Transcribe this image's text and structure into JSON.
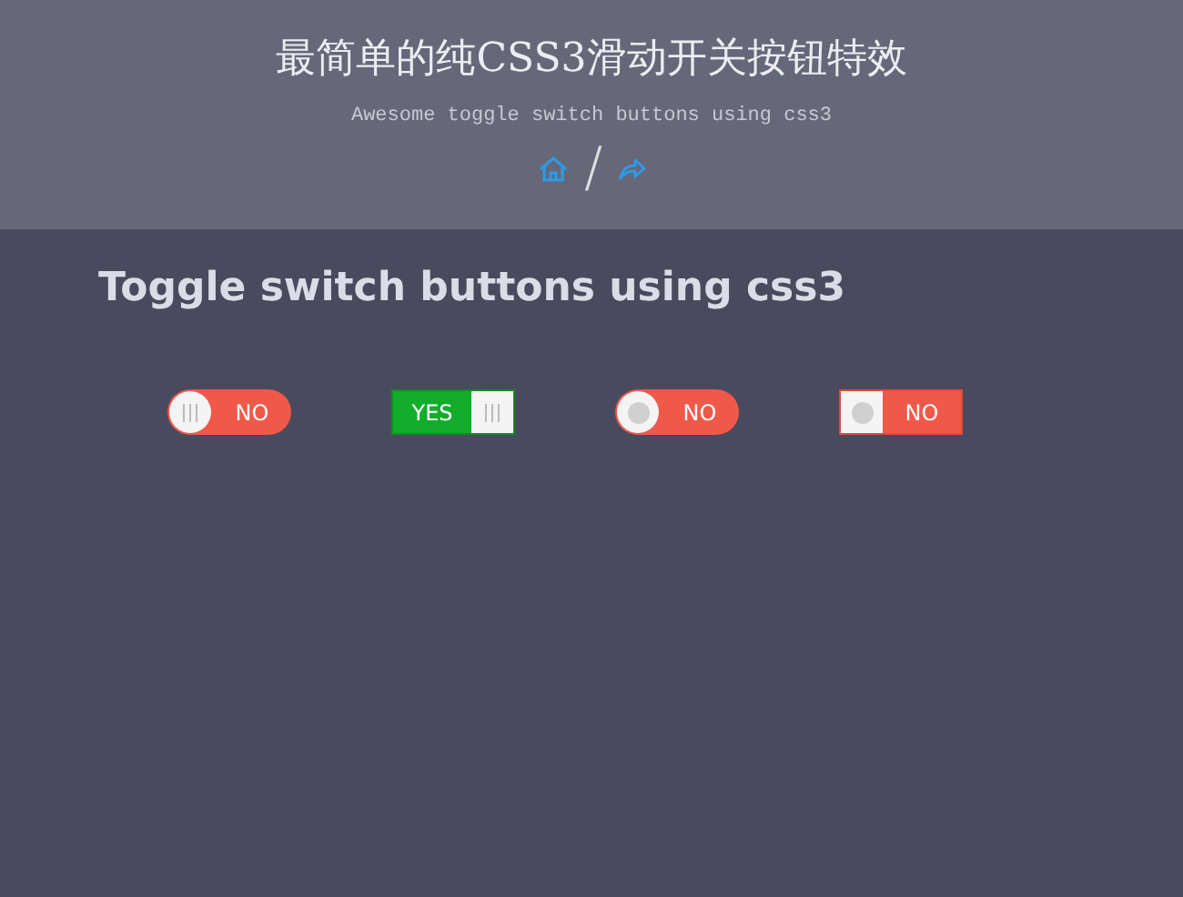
{
  "header": {
    "title": "最简单的纯CSS3滑动开关按钮特效",
    "subtitle": "Awesome toggle switch buttons using css3",
    "separator": "/"
  },
  "heading": "Toggle switch buttons using css3",
  "toggles": [
    {
      "kind": "round-lines",
      "on": false,
      "label": "NO"
    },
    {
      "kind": "square-lines",
      "on": true,
      "label": "YES"
    },
    {
      "kind": "round-dot",
      "on": false,
      "label": "NO"
    },
    {
      "kind": "square-dot",
      "on": false,
      "label": "NO"
    }
  ]
}
